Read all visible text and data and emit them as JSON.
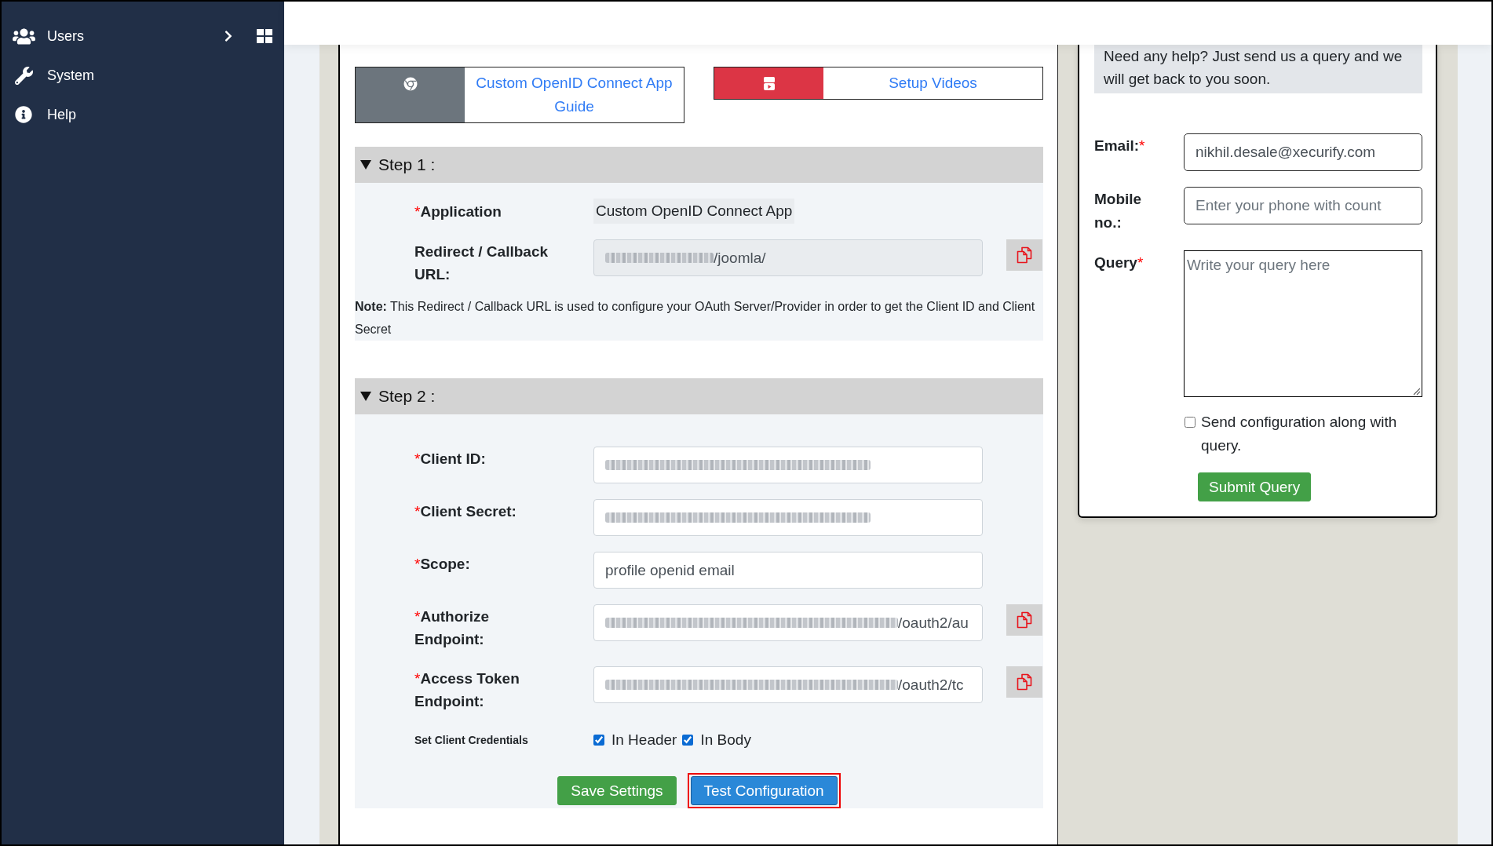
{
  "sidebar": {
    "items": [
      {
        "label": "Users",
        "expandable": true
      },
      {
        "label": "System",
        "expandable": false
      },
      {
        "label": "Help",
        "expandable": false
      }
    ]
  },
  "guides": [
    {
      "kind": "guide",
      "label": "Custom OpenID Connect App Guide"
    },
    {
      "kind": "video",
      "label": "Setup Videos"
    }
  ],
  "steps": [
    {
      "title": "Step 1 :",
      "expanded": true,
      "fields": [
        {
          "kind": "static",
          "mark": "*",
          "label": "Application",
          "value": "Custom OpenID Connect App"
        },
        {
          "kind": "input",
          "label": "Redirect / Callback URL:",
          "redacted": true,
          "value": "/joomla/",
          "disabled": true,
          "copyable": true
        }
      ],
      "note": "**Note:** This Redirect / Callback URL is used to configure your OAuth Server/Provider in order to get the Client ID and Client Secret"
    },
    {
      "title": "Step 2 :",
      "expanded": true,
      "fields": [
        {
          "kind": "input",
          "mark": "*",
          "label": "Client ID:",
          "redacted": true,
          "disabled": false,
          "copyable": false
        },
        {
          "kind": "input",
          "mark": "*",
          "label": "Client Secret:",
          "redacted": true,
          "disabled": false,
          "copyable": false
        },
        {
          "kind": "input",
          "mark": "*",
          "label": "Scope:",
          "redacted": false,
          "value": "profile openid email",
          "disabled": false,
          "copyable": false
        },
        {
          "kind": "input",
          "mark": "*",
          "label": "Authorize Endpoint:",
          "redacted": true,
          "value": "/oauth2/au",
          "disabled": false,
          "copyable": true
        },
        {
          "kind": "input",
          "mark": "*",
          "label": "Access Token Endpoint:",
          "redacted": true,
          "value": "/oauth2/tc",
          "disabled": false,
          "copyable": true
        }
      ],
      "credentials": {
        "label": "Set Client Credentials",
        "options": [
          {
            "label": "In Header",
            "checked": true
          },
          {
            "label": "In Body",
            "checked": true
          }
        ]
      },
      "buttons": [
        {
          "kind": "save",
          "label": "Save Settings",
          "highlighted": false
        },
        {
          "kind": "test",
          "label": "Test Configuration",
          "highlighted": true
        }
      ]
    }
  ],
  "support": {
    "intro": "Need any help? Just send us a query and we will get back to you soon.",
    "fields": [
      {
        "kind": "input",
        "label": "Email:",
        "mark": "*",
        "value": "nikhil.desale@xecurify.com"
      },
      {
        "kind": "input",
        "label": "Mobile no.:",
        "placeholder": "Enter your phone with count"
      },
      {
        "kind": "textarea",
        "label": "Query",
        "mark": "*",
        "placeholder": "Write your query here"
      }
    ],
    "send_config": {
      "label": "Send configuration along with query.",
      "checked": false
    },
    "submit": "Submit Query"
  }
}
